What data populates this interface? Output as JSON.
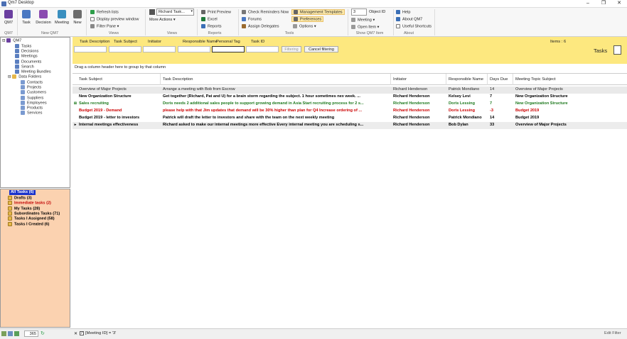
{
  "window": {
    "title": "Qm7 Desktop"
  },
  "ribbon": {
    "qm7_label": "QM7",
    "task_label": "Task",
    "decision_label": "Decision",
    "meeting_label": "Meeting",
    "new_label": "New",
    "refresh": "Refresh lists",
    "preview": "Display preview window",
    "filter_pane": "Filter Pane",
    "user_select": "Richard Task...",
    "more_actions": "More Actions",
    "print_preview": "Print Preview",
    "excel": "Excel",
    "reports": "Reports",
    "check_reminders": "Check Reminders Now",
    "forums": "Forums",
    "assign_delegates": "Assign Delegates",
    "mgmt_templates": "Management Templates",
    "preferences": "Preferences",
    "options": "Options",
    "object_id_value": "3",
    "object_id_label": "Object ID",
    "meeting_select": "Meeting",
    "open_item": "Open Item",
    "help": "Help",
    "about": "About QM7",
    "shortcuts": "Useful Shortcuts",
    "groups": [
      "QM7",
      "New QM7",
      "Views",
      "Views",
      "Reports",
      "Tools",
      "Show QM7 Item",
      "About"
    ]
  },
  "nav": {
    "root": "QM7",
    "items": [
      "Tasks",
      "Decisions",
      "Meetings",
      "Documents",
      "Search",
      "Meeting Bundles"
    ],
    "data_folders": "Data Folders",
    "folder_items": [
      "Contacts",
      "Projects",
      "Customers",
      "Suppliers",
      "Employees",
      "Products",
      "Services"
    ]
  },
  "task_tree": {
    "root": "All Tasks (6)",
    "items": [
      {
        "label": "Drafts (3)",
        "color": "#000000"
      },
      {
        "label": "Immediate tasks (2)",
        "color": "#c00000"
      },
      {
        "label": "My Tasks (28)",
        "color": "#000000"
      },
      {
        "label": "Subordinates Tasks (71)",
        "color": "#000000"
      },
      {
        "label": "Tasks I Assigned (58)",
        "color": "#000000"
      },
      {
        "label": "Tasks I Created (6)",
        "color": "#000000"
      }
    ]
  },
  "filter": {
    "labels": [
      "Task Description",
      "Task Subject",
      "Initiator",
      "Responsible Name",
      "Personal Tag",
      "Task ID"
    ],
    "filtering_btn": "Filtering",
    "cancel_btn": "Cancel filtering",
    "items_count": "Items : 6",
    "pane_title": "Tasks",
    "group_label": "Filtering"
  },
  "grid": {
    "group_hint": "Drag a column header here to group by that column",
    "columns": [
      "Task Subject",
      "Task Description",
      "Initiator",
      "Responsible Name",
      "Days Due",
      "Meeting Topic Subject"
    ],
    "rows": [
      {
        "ind": "",
        "cells": [
          "Overview of Major Projects",
          "Arrange a meeting with Bob from Escrow",
          "Richard Henderson",
          "Patrick Mondiano",
          "14",
          "Overview of Major Projects"
        ],
        "color": "#222222",
        "bold": false,
        "bg": "#e9e9e9"
      },
      {
        "ind": "",
        "cells": [
          "New Organization Structure",
          "Get together (Richard, Pat and U) for a brain storm regarding the subject. 1 hour sometimes nex week. ...",
          "Richard Henderson",
          "Kelsey Levi",
          "7",
          "New Organization Structure"
        ],
        "color": "#000000",
        "bold": true,
        "bg": "#ffffff"
      },
      {
        "ind": "⊞",
        "cells": [
          "Sales recruiting",
          "Doris needs 2 additional sales people to support growing demand in Asia Start recruiting process for 2 s...",
          "Richard Henderson",
          "Doris Lessing",
          "7",
          "New Organization Structure"
        ],
        "color": "#1f7a1f",
        "bold": true,
        "bg": "#ffffff"
      },
      {
        "ind": "",
        "cells": [
          "Budget 2019 - Demand",
          "please help with that  Jim updates that demand will be 30% higher than plan for Q4 Increase ordering of ...",
          "Richard Henderson",
          "Doris Lessing",
          "-3",
          "Budget 2019"
        ],
        "color": "#cc0000",
        "bold": true,
        "bg": "#ffffff"
      },
      {
        "ind": "",
        "cells": [
          "Budget 2019 - letter to investors",
          "Patrick will draft the letter to investors and share with the team on the next weekly meeting",
          "Richard Henderson",
          "Patrick Mondiano",
          "14",
          "Budget 2019"
        ],
        "color": "#000000",
        "bold": true,
        "bg": "#ffffff"
      },
      {
        "ind": "▸",
        "cells": [
          "Internal meetings effectiveness",
          "Richard asked to make our internal meetings more effective Every internal meeting you are scheduling s...",
          "Richard Henderson",
          "Bob Dylan",
          "33",
          "Overview of Major Projects"
        ],
        "color": "#000000",
        "bold": true,
        "bg": "#ececec"
      }
    ]
  },
  "status": {
    "counter": "365",
    "filter_text": "[Meeting ID] = '3'",
    "edit_filter": "Edit Filter"
  },
  "colors": {
    "filter_bg": "#fde87f",
    "tree_bg": "#fbd2b0",
    "selected": "#1a33cc"
  }
}
